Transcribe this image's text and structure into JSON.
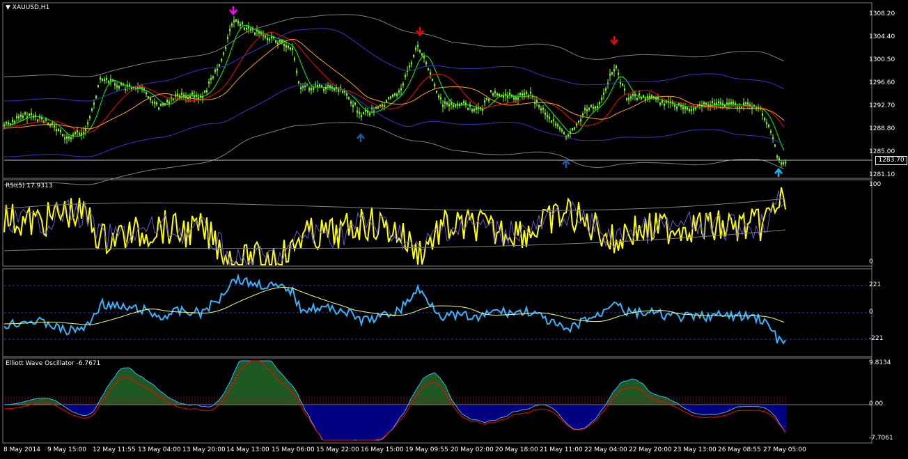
{
  "main_panel": {
    "title": "XAUUSD,H1",
    "y_ticks": [
      "1308.20",
      "1304.40",
      "1300.50",
      "1296.60",
      "1292.70",
      "1288.80",
      "1285.00",
      "1281.10"
    ],
    "current_price": "1283.70"
  },
  "rsi_panel": {
    "title": "RSI(5) 17.9313",
    "y_ticks": [
      "100",
      "0"
    ]
  },
  "cci_panel": {
    "y_ticks": [
      "221",
      "0",
      "-221"
    ]
  },
  "ewo_panel": {
    "title": "Elliott Wave Oscillator -6.7671",
    "y_ticks": [
      "9.8134",
      "0.00",
      "-7.7061"
    ]
  },
  "x_axis": {
    "labels": [
      "8 May 2014",
      "9 May 15:00",
      "12 May 11:55",
      "13 May 04:00",
      "13 May 20:00",
      "14 May 13:00",
      "15 May 06:00",
      "15 May 22:00",
      "16 May 15:00",
      "19 May 09:55",
      "20 May 02:00",
      "20 May 18:00",
      "21 May 11:00",
      "22 May 04:00",
      "22 May 20:00",
      "23 May 13:00",
      "26 May 08:55",
      "27 May 05:00"
    ]
  },
  "colors": {
    "background": "#000000",
    "candles": "#7CFC00",
    "rsi_line": "#FFFF00",
    "cci_line": "#33B5FF",
    "ewo_positive": "#3CB043",
    "ewo_negative": "#0000FF",
    "arrow_up": "#1E5AA8",
    "arrow_down": "#FF0000",
    "arrow_top": "#FF00FF",
    "arrow_last": "#00BFFF"
  }
}
